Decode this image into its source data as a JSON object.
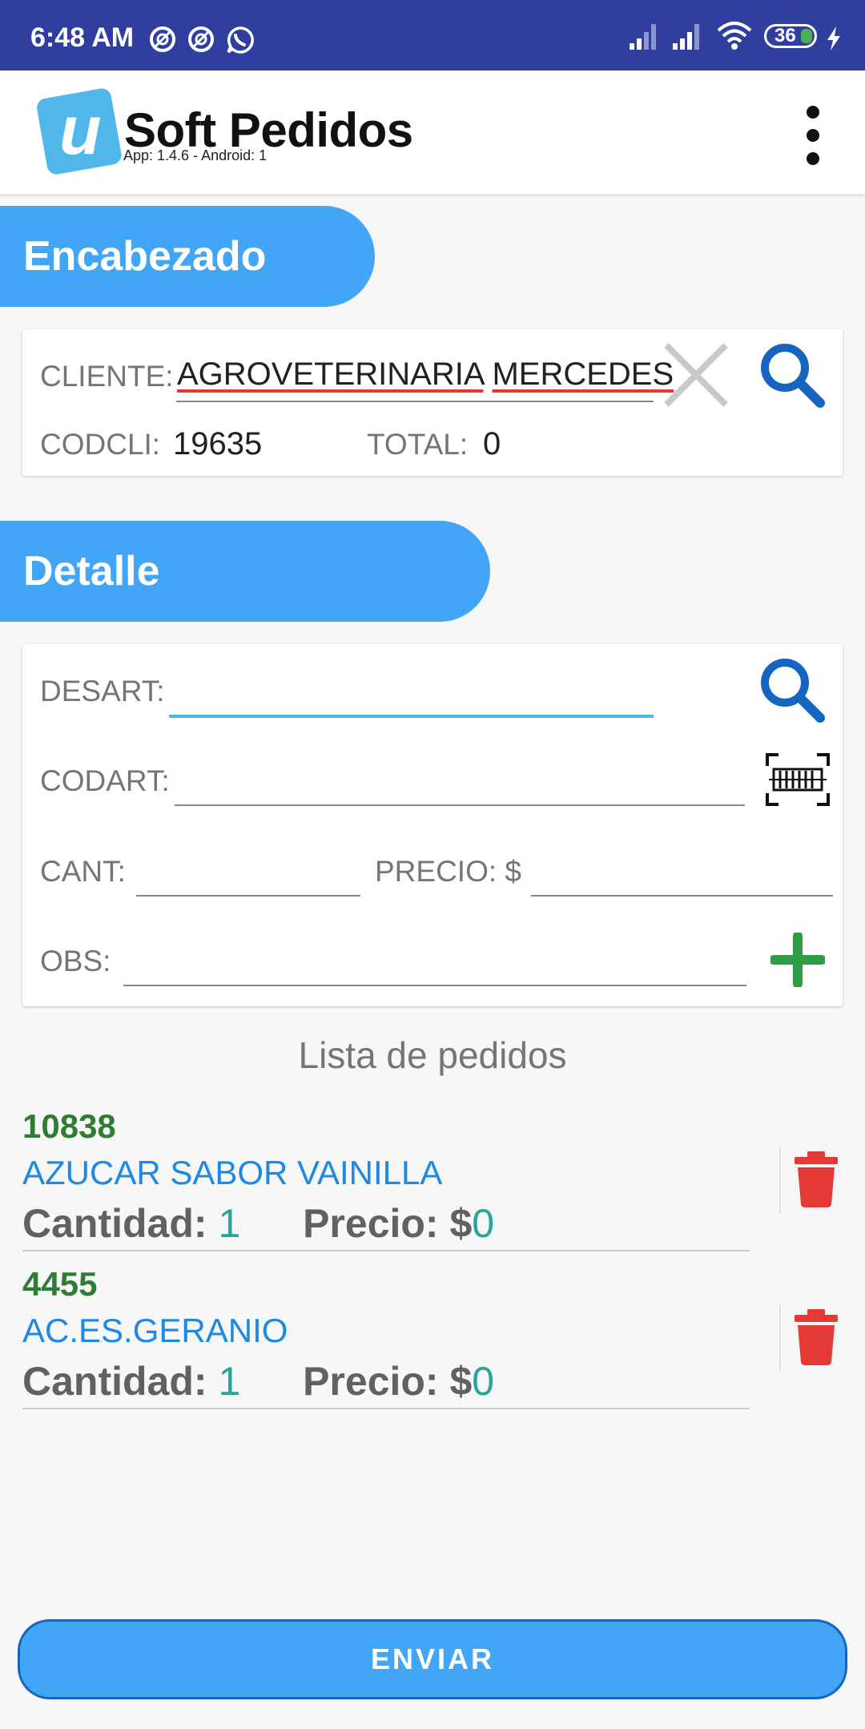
{
  "status_bar": {
    "time": "6:48 AM",
    "battery": "36",
    "icons": [
      "notification-icon",
      "notification-icon",
      "whatsapp-icon",
      "signal-icon",
      "signal-icon",
      "wifi-icon",
      "battery-icon",
      "charging-icon"
    ]
  },
  "app_bar": {
    "title": "Soft Pedidos",
    "version": "App: 1.4.6 - Android: 1",
    "logo_letter": "u"
  },
  "encabezado": {
    "section_title": "Encabezado",
    "cliente_label": "CLIENTE:",
    "cliente_words": [
      "AGROVETERINARIA",
      "MERCEDES"
    ],
    "codcli_label": "CODCLI:",
    "codcli_value": "19635",
    "total_label": "TOTAL:",
    "total_value": "0"
  },
  "detalle": {
    "section_title": "Detalle",
    "desart_label": "DESART:",
    "desart_value": "",
    "codart_label": "CODART:",
    "codart_value": "",
    "cant_label": "CANT:",
    "cant_value": "",
    "precio_label": "PRECIO: $",
    "precio_value": "",
    "obs_label": "OBS:",
    "obs_value": ""
  },
  "lista": {
    "title": "Lista de pedidos",
    "cantidad_label": "Cantidad:",
    "precio_label": "Precio: $",
    "items": [
      {
        "code": "10838",
        "name": "AZUCAR SABOR VAINILLA",
        "cantidad": "1",
        "precio": "0"
      },
      {
        "code": "4455",
        "name": "AC.ES.GERANIO",
        "cantidad": "1",
        "precio": "0"
      }
    ]
  },
  "send_button": {
    "label": "ENVIAR"
  },
  "colors": {
    "status_bar": "#303f9f",
    "accent": "#42a5f5",
    "search_icon": "#1565c0",
    "add_icon": "#2e9e44",
    "delete_icon": "#e53935",
    "item_code": "#2e7d32",
    "item_name": "#1e88e5"
  }
}
